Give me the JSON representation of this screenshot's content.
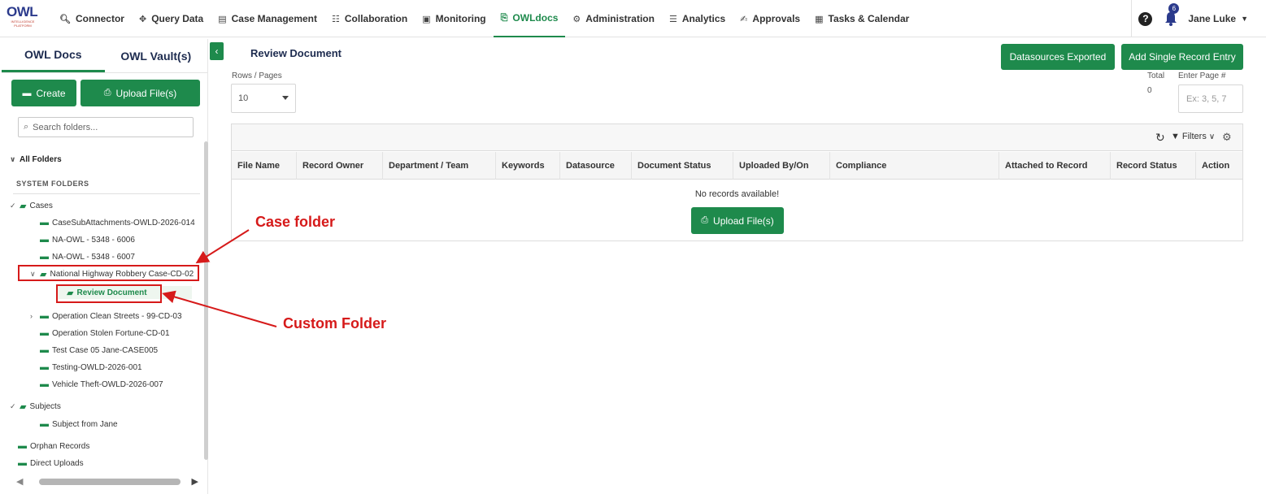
{
  "app": {
    "logo_text": "OWL",
    "logo_subtext": "INTELLIGENCE PLATFORM"
  },
  "nav": {
    "items": [
      {
        "label": "Connector",
        "icon": "search-icon"
      },
      {
        "label": "Query Data",
        "icon": "move-icon"
      },
      {
        "label": "Case Management",
        "icon": "briefcase-icon"
      },
      {
        "label": "Collaboration",
        "icon": "users-icon"
      },
      {
        "label": "Monitoring",
        "icon": "monitor-icon"
      },
      {
        "label": "OWLdocs",
        "icon": "file-icon",
        "active": true
      },
      {
        "label": "Administration",
        "icon": "admin-icon"
      },
      {
        "label": "Analytics",
        "icon": "document-icon"
      },
      {
        "label": "Approvals",
        "icon": "approval-icon"
      },
      {
        "label": "Tasks & Calendar",
        "icon": "calendar-icon"
      }
    ],
    "notification_count": "6",
    "user_name": "Jane Luke"
  },
  "left": {
    "tabs": [
      "OWL Docs",
      "OWL Vault(s)"
    ],
    "create_label": "Create",
    "upload_label": "Upload File(s)",
    "search_placeholder": "Search folders...",
    "all_folders": "All Folders",
    "system_folders_label": "SYSTEM FOLDERS",
    "cases_label": "Cases",
    "cases": [
      "CaseSubAttachments-OWLD-2026-014",
      "NA-OWL - 5348 - 6006",
      "NA-OWL - 5348 - 6007",
      "National Highway Robbery Case-CD-02",
      "Review Document",
      "Operation Clean Streets - 99-CD-03",
      "Operation Stolen Fortune-CD-01",
      "Test Case 05 Jane-CASE005",
      "Testing-OWLD-2026-001",
      "Vehicle Theft-OWLD-2026-007"
    ],
    "subjects_label": "Subjects",
    "subjects": [
      "Subject from Jane"
    ],
    "orphan_label": "Orphan Records",
    "direct_label": "Direct Uploads"
  },
  "main": {
    "title": "Review Document",
    "datasources_btn": "Datasources Exported",
    "add_btn": "Add Single Record Entry",
    "rows_label": "Rows / Pages",
    "rows_value": "10",
    "total_label": "Total",
    "total_value": "0",
    "page_label": "Enter Page #",
    "page_placeholder": "Ex: 3, 5, 7",
    "filters_label": "Filters",
    "columns": [
      "File Name",
      "Record Owner",
      "Department / Team",
      "Keywords",
      "Datasource",
      "Document Status",
      "Uploaded By/On",
      "Compliance",
      "Attached to Record",
      "Record Status",
      "Action"
    ],
    "no_records": "No records available!",
    "upload_btn": "Upload File(s)"
  },
  "annotations": {
    "case_folder": "Case folder",
    "custom_folder": "Custom Folder",
    "color": "#d61a1a"
  },
  "colors": {
    "accent": "#1e8a4c",
    "navy": "#1d2b4f"
  }
}
